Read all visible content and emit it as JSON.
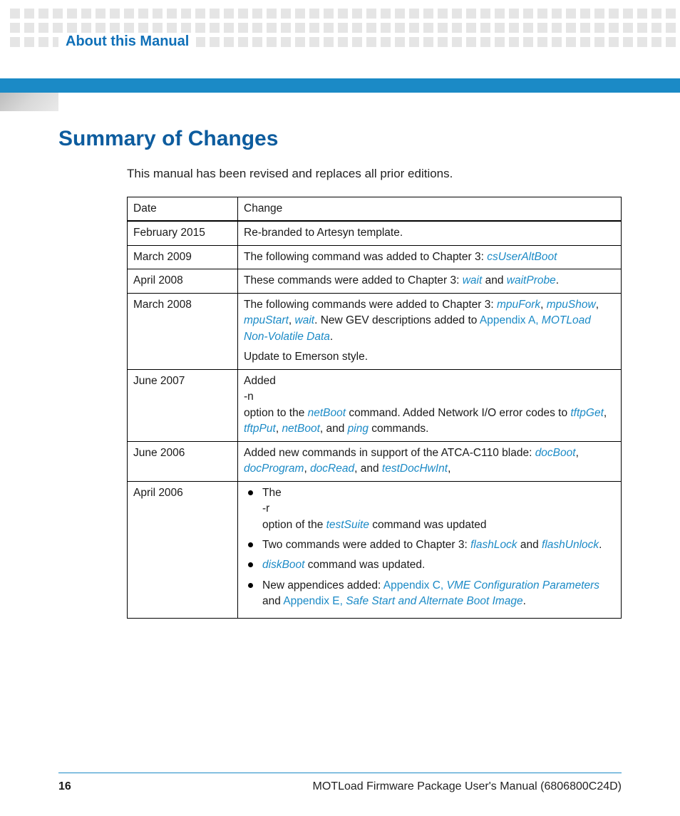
{
  "header": {
    "section_label": "About this Manual"
  },
  "main": {
    "heading": "Summary of Changes",
    "intro": "This manual has been revised and replaces all prior editions.",
    "table": {
      "headers": {
        "date": "Date",
        "change": "Change"
      },
      "rows": {
        "r0": {
          "date": "February 2015",
          "change": "Re-branded to Artesyn template."
        },
        "r1": {
          "date": "March 2009",
          "pre": "The following command was added to Chapter 3: ",
          "link": "csUserAltBoot"
        },
        "r2": {
          "date": "April 2008",
          "pre": "These commands were added to Chapter 3: ",
          "l1": "wait",
          "mid": " and ",
          "l2": "waitProbe",
          "post": "."
        },
        "r3": {
          "date": "March 2008",
          "pre": "The following commands were added to Chapter 3: ",
          "l1": "mpuFork",
          "c1": ", ",
          "l2": "mpuShow",
          "c2": ", ",
          "l3": "mpuStart",
          "c3": ", ",
          "l4": "wait",
          "mid": ". New GEV descriptions added to ",
          "appx": "Appendix A, ",
          "appxt": "MOTLoad Non-Volatile Data",
          "post": ".",
          "line2": "Update to Emerson style."
        },
        "r4": {
          "date": "June 2007",
          "line1": "Added",
          "line2": "-n",
          "pre": " option to the ",
          "l1": "netBoot",
          "mid": " command. Added Network I/O error codes to ",
          "l2": "tftpGet",
          "c1": ", ",
          "l3": "tftpPut",
          "c2": ", ",
          "l4": "netBoot",
          "c3": ", and ",
          "l5": "ping",
          "post": " commands."
        },
        "r5": {
          "date": "June 2006",
          "pre": "Added new commands in support of the ATCA-C110 blade: ",
          "l1": "docBoot",
          "c1": ", ",
          "l2": "docProgram",
          "c2": ",  ",
          "l3": "docRead",
          "c3": ",  and ",
          "l4": "testDocHwInt",
          "post": ","
        },
        "r6": {
          "date": "April 2006",
          "b1_l1": "The",
          "b1_l2": "-r",
          "b1_pre": " option of the ",
          "b1_link": "testSuite",
          "b1_post": " command was updated",
          "b2_pre": "Two commands were added to Chapter 3: ",
          "b2_l1": "flashLock",
          "b2_mid": " and ",
          "b2_l2": "flashUnlock",
          "b2_post": ".",
          "b3_l1": "diskBoot",
          "b3_post": " command was updated.",
          "b4_pre": "New appendices added: ",
          "b4_a1": "Appendix C, ",
          "b4_a1t": "VME Configuration Parameters",
          "b4_mid": "  and ",
          "b4_a2": "Appendix E, ",
          "b4_a2t": "Safe Start and Alternate Boot Image",
          "b4_post": "."
        }
      }
    }
  },
  "footer": {
    "page_number": "16",
    "manual_title": "MOTLoad Firmware Package User's Manual (6806800C24D)"
  }
}
